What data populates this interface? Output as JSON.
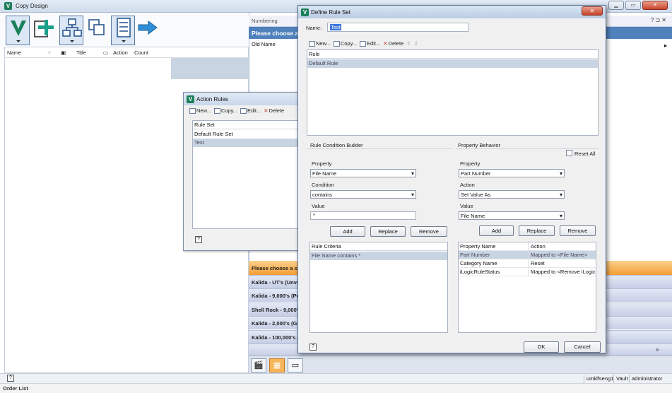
{
  "main_window": {
    "title": "Copy Design",
    "controls": [
      "▁",
      "▭",
      "✕"
    ]
  },
  "left_pane": {
    "columns": [
      "Name",
      "Title",
      "Action",
      "Count"
    ]
  },
  "numbering": {
    "header": "Numbering",
    "choose_text": "Please choose a",
    "old_name_label": "Old Name",
    "header_icons": "? ⊐ ✕"
  },
  "series": {
    "banner": "Please choose a seri",
    "rows": [
      "Kalida - UT's (Unver",
      "Kalida - 9,000's (Pur",
      "Shell Rock - 9,000's",
      "Kalida - 2,000's (Gra",
      "Kalida - 100,000's (W"
    ]
  },
  "status_bar": {
    "help": "?",
    "user_host": "umklfseng1",
    "area": "Vault",
    "user": "administrator"
  },
  "below": {
    "order_list": "Order List"
  },
  "action_rules": {
    "title": "Action Rules",
    "toolbar": {
      "new": "New...",
      "copy": "Copy...",
      "edit": "Edit...",
      "delete": "Delete"
    },
    "list_header": "Rule Set",
    "rows": [
      "Default Rule Set",
      "Test"
    ],
    "help": "?"
  },
  "define_rule_set": {
    "title": "Define Rule Set",
    "name_label": "Name:",
    "name_value": "Test",
    "toolbar": {
      "new": "New...",
      "copy": "Copy...",
      "edit": "Edit...",
      "delete": "Delete"
    },
    "rule_header": "Rule",
    "rules": [
      "Default Rule"
    ],
    "condition_builder": {
      "title": "Rule Condition Builder",
      "property_label": "Property",
      "property_value": "File Name",
      "condition_label": "Condition",
      "condition_value": "contains",
      "value_label": "Value",
      "value_value": "*",
      "add": "Add",
      "replace": "Replace",
      "remove": "Remove",
      "criteria_header": "Rule Criteria",
      "criteria": [
        "File Name contains *"
      ]
    },
    "property_behavior": {
      "title": "Property Behavior",
      "reset_all": "Reset All",
      "property_label": "Property",
      "property_value": "Part Number",
      "action_label": "Action",
      "action_value": "Set Value As",
      "value_label": "Value",
      "value_value": "File Name",
      "add": "Add",
      "replace": "Replace",
      "remove": "Remove",
      "grid_headers": [
        "Property Name",
        "Action"
      ],
      "grid_rows": [
        [
          "Part Number",
          "Mapped to <File Name>"
        ],
        [
          "Category Name",
          "Reset"
        ],
        [
          "iLogicRuleStatus",
          "Mapped to <Remove iLogic..."
        ]
      ]
    },
    "help": "?",
    "ok": "OK",
    "cancel": "Cancel"
  },
  "colors": {
    "accent_blue": "#4f81bd",
    "series_orange": "#f59d35",
    "app_green": "#1b7f5a"
  }
}
